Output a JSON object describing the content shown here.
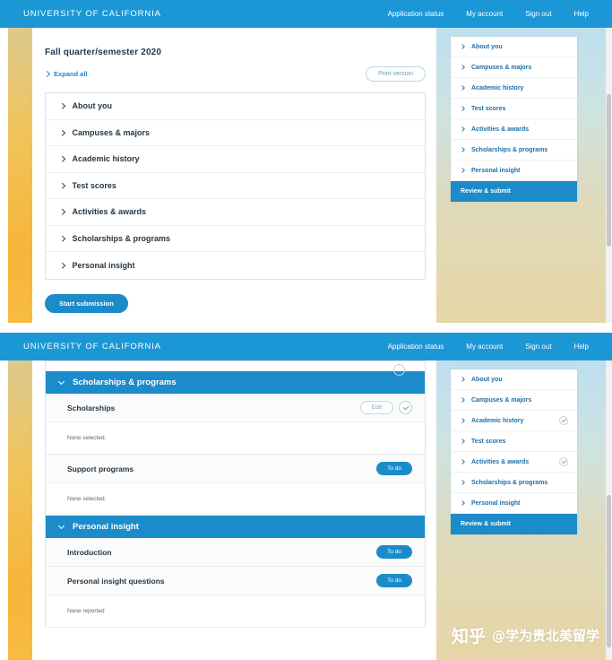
{
  "header": {
    "brand": "UNIVERSITY OF CALIFORNIA",
    "nav": [
      {
        "label": "Application status"
      },
      {
        "label": "My account"
      },
      {
        "label": "Sign out"
      },
      {
        "label": "Help"
      }
    ]
  },
  "panel1": {
    "page_title": "Fall quarter/semester 2020",
    "expand_all_label": "Expand all",
    "print_version_label": "Print version",
    "accordion": [
      {
        "label": "About you"
      },
      {
        "label": "Campuses & majors"
      },
      {
        "label": "Academic history"
      },
      {
        "label": "Test scores"
      },
      {
        "label": "Activities & awards"
      },
      {
        "label": "Scholarships & programs"
      },
      {
        "label": "Personal insight"
      }
    ],
    "start_submission_label": "Start submission",
    "sidenav": {
      "items": [
        {
          "label": "About you",
          "complete": false
        },
        {
          "label": "Campuses & majors",
          "complete": false
        },
        {
          "label": "Academic history",
          "complete": false
        },
        {
          "label": "Test scores",
          "complete": false
        },
        {
          "label": "Activities & awards",
          "complete": false
        },
        {
          "label": "Scholarships & programs",
          "complete": false
        },
        {
          "label": "Personal insight",
          "complete": false
        }
      ],
      "cta_label": "Review & submit"
    }
  },
  "panel2": {
    "sections": [
      {
        "title": "Scholarships & programs",
        "rows": [
          {
            "title": "Scholarships",
            "action": "Edit",
            "action_type": "edit",
            "complete": true,
            "note": "None selected."
          },
          {
            "title": "Support programs",
            "action": "To do",
            "action_type": "todo",
            "complete": false,
            "note": "None selected."
          }
        ]
      },
      {
        "title": "Personal insight",
        "rows": [
          {
            "title": "Introduction",
            "action": "To do",
            "action_type": "todo",
            "complete": false,
            "note": ""
          },
          {
            "title": "Personal insight questions",
            "action": "To do",
            "action_type": "todo",
            "complete": false,
            "note": "None reported"
          }
        ]
      }
    ],
    "sidenav": {
      "items": [
        {
          "label": "About you",
          "complete": false
        },
        {
          "label": "Campuses & majors",
          "complete": false
        },
        {
          "label": "Academic history",
          "complete": true
        },
        {
          "label": "Test scores",
          "complete": false
        },
        {
          "label": "Activities & awards",
          "complete": true
        },
        {
          "label": "Scholarships & programs",
          "complete": false
        },
        {
          "label": "Personal insight",
          "complete": false
        }
      ],
      "cta_label": "Review & submit"
    }
  },
  "watermark": {
    "logo": "知乎",
    "text": "@学为贵北美留学"
  },
  "colors": {
    "brand_blue": "#1b97d5",
    "accent_blue": "#1b8bc9",
    "gold": "#f6b53a",
    "check_green": "#7fa995"
  }
}
